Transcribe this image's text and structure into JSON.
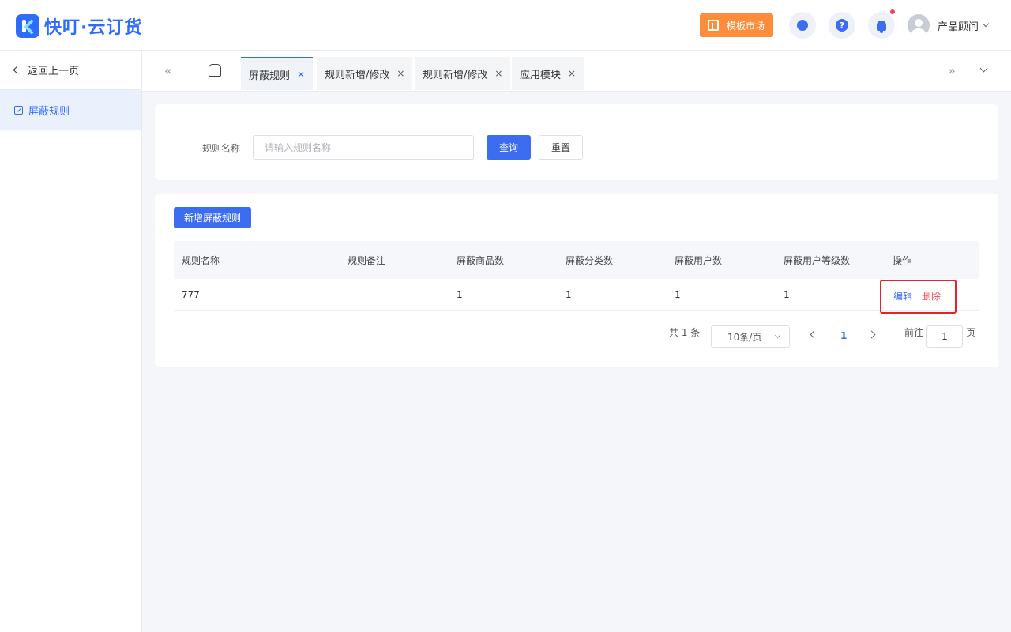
{
  "header": {
    "logo_text": "快叮·云订货",
    "market_label": "模板市场",
    "help_glyph": "?",
    "user_name": "产品顾问"
  },
  "sidebar": {
    "back_label": "返回上一页",
    "items": [
      {
        "label": "屏蔽规则",
        "icon": "checkbox-icon",
        "active": true
      }
    ]
  },
  "tabs": {
    "prev_glyph": "«",
    "next_glyph": "»",
    "close_glyph": "×",
    "items": [
      {
        "label": "屏蔽规则",
        "active": true
      },
      {
        "label": "规则新增/修改",
        "active": false
      },
      {
        "label": "规则新增/修改",
        "active": false
      },
      {
        "label": "应用模块",
        "active": false
      }
    ]
  },
  "filter": {
    "label": "规则名称",
    "placeholder": "请输入规则名称",
    "value": "",
    "query_label": "查询",
    "reset_label": "重置"
  },
  "table": {
    "add_label": "新增屏蔽规则",
    "columns": [
      "规则名称",
      "规则备注",
      "屏蔽商品数",
      "屏蔽分类数",
      "屏蔽用户数",
      "屏蔽用户等级数",
      "操作"
    ],
    "rows": [
      {
        "name": "777",
        "remark": "",
        "products": "1",
        "categories": "1",
        "users": "1",
        "user_levels": "1",
        "edit_label": "编辑",
        "delete_label": "删除"
      }
    ]
  },
  "pagination": {
    "total_text": "共 1 条",
    "page_size": "10条/页",
    "current_page": "1",
    "goto_label": "前往",
    "goto_value": "1",
    "page_suffix": "页"
  },
  "colors": {
    "primary": "#3c6df0",
    "danger": "#f5424b",
    "market": "#ff8c3a"
  }
}
